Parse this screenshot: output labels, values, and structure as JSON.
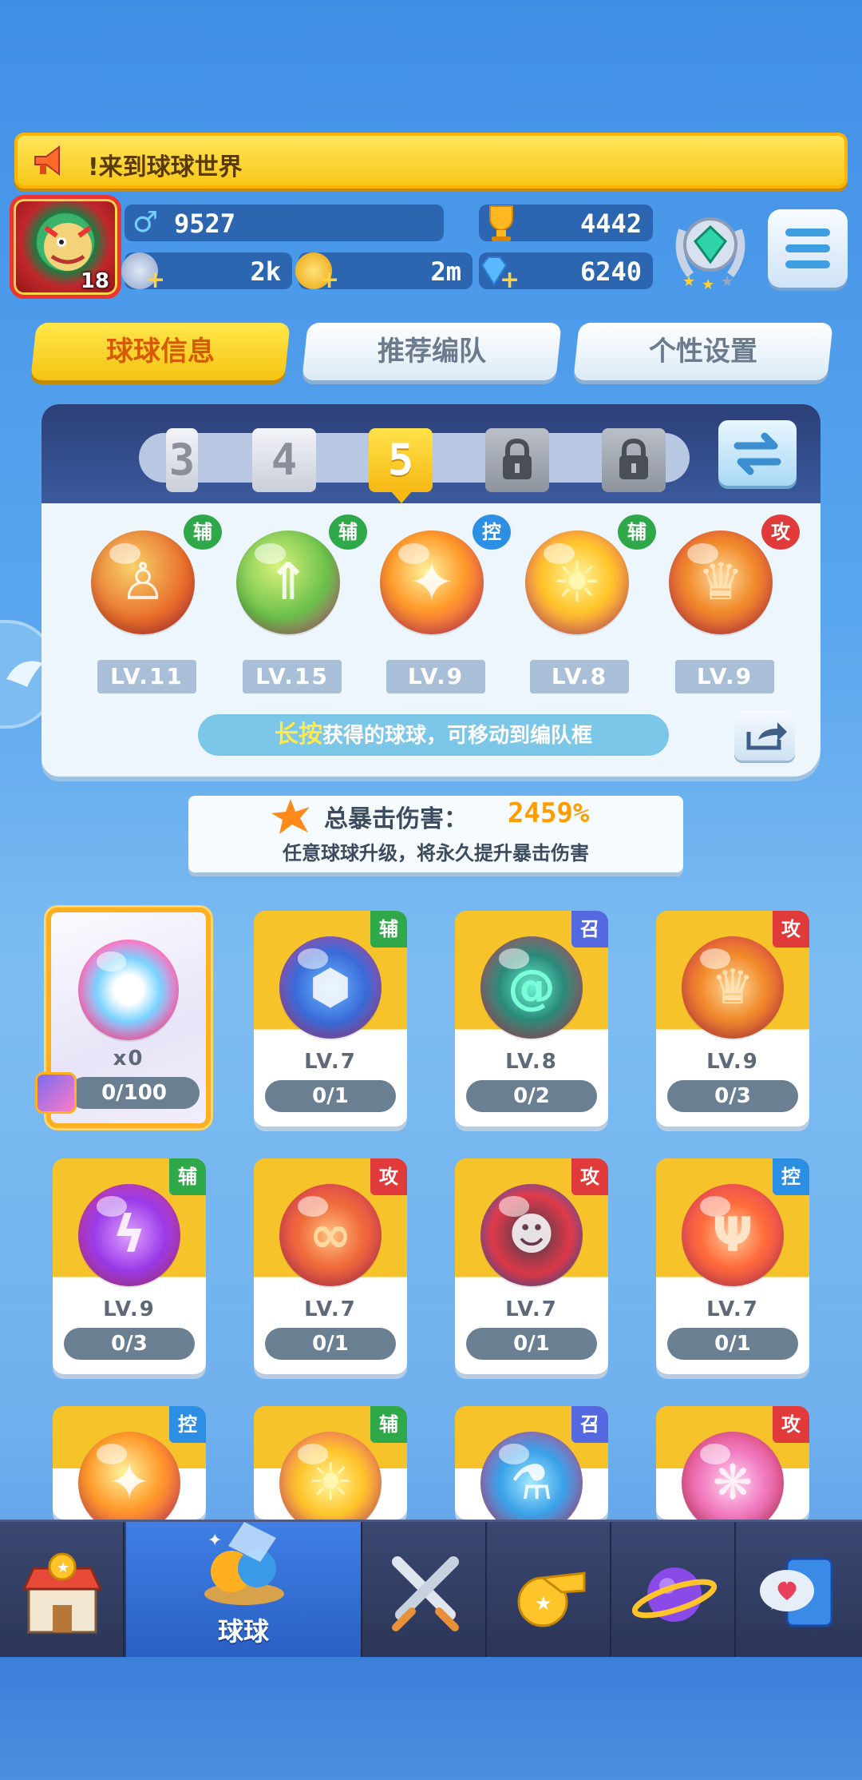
{
  "marquee": {
    "text": "!来到球球世界"
  },
  "player": {
    "level": "18",
    "stats": {
      "male": "9527",
      "trophy": "4442",
      "stars": "2k",
      "coins": "2m",
      "gems": "6240"
    }
  },
  "tabs": [
    {
      "label": "球球信息"
    },
    {
      "label": "推荐编队"
    },
    {
      "label": "个性设置"
    }
  ],
  "team": {
    "slots": [
      "3",
      "4",
      "5",
      "",
      ""
    ],
    "active_slot": "5",
    "balls": [
      {
        "tag": "辅",
        "level": "LV.11"
      },
      {
        "tag": "辅",
        "level": "LV.15"
      },
      {
        "tag": "控",
        "level": "LV.9"
      },
      {
        "tag": "辅",
        "level": "LV.8"
      },
      {
        "tag": "攻",
        "level": "LV.9"
      }
    ],
    "hint_highlight": "长按",
    "hint_rest": "获得的球球，可移动到编队框"
  },
  "crit": {
    "label": "总暴击伤害：",
    "value": "2459%",
    "desc": "任意球球升级，将永久提升暴击伤害"
  },
  "cards": [
    {
      "tag": "",
      "level": "x0",
      "count": "0/100"
    },
    {
      "tag": "辅",
      "level": "LV.7",
      "count": "0/1"
    },
    {
      "tag": "召",
      "level": "LV.8",
      "count": "0/2"
    },
    {
      "tag": "攻",
      "level": "LV.9",
      "count": "0/3"
    },
    {
      "tag": "辅",
      "level": "LV.9",
      "count": "0/3"
    },
    {
      "tag": "攻",
      "level": "LV.7",
      "count": "0/1"
    },
    {
      "tag": "攻",
      "level": "LV.7",
      "count": "0/1"
    },
    {
      "tag": "控",
      "level": "LV.7",
      "count": "0/1"
    },
    {
      "tag": "控",
      "level": "",
      "count": ""
    },
    {
      "tag": "辅",
      "level": "",
      "count": ""
    },
    {
      "tag": "召",
      "level": "",
      "count": ""
    },
    {
      "tag": "攻",
      "level": "",
      "count": ""
    }
  ],
  "nav": {
    "active_label": "球球"
  },
  "colors": {
    "accent_yellow": "#f6c313",
    "tag_support": "#2fa84a",
    "tag_control": "#2d8fe3",
    "tag_attack": "#e03a3a",
    "tag_summon": "#5468e0"
  }
}
